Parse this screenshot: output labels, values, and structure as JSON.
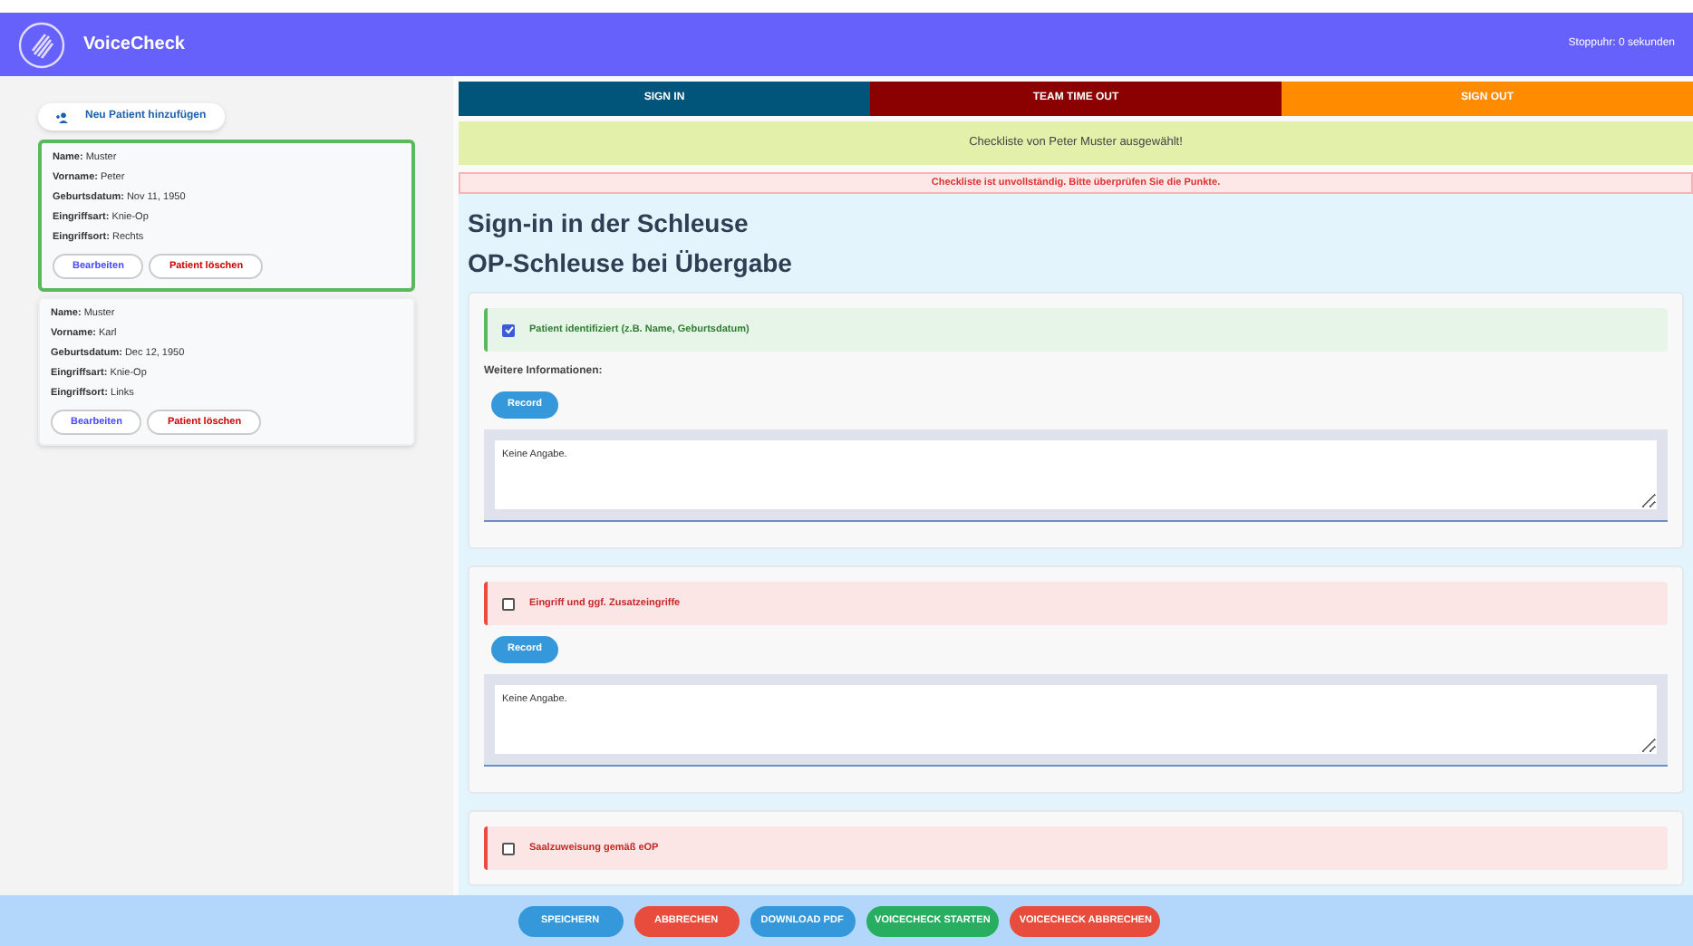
{
  "header": {
    "title": "VoiceCheck",
    "stopwatch": "Stoppuhr: 0 sekunden"
  },
  "sidebar": {
    "add_button": "Neu Patient hinzufügen",
    "patients": [
      {
        "selected": true,
        "fields": [
          {
            "label": "Name:",
            "value": "Muster"
          },
          {
            "label": "Vorname:",
            "value": "Peter"
          },
          {
            "label": "Geburtsdatum:",
            "value": "Nov 11, 1950"
          },
          {
            "label": "Eingriffsart:",
            "value": "Knie-Op"
          },
          {
            "label": "Eingriffsort:",
            "value": "Rechts"
          }
        ],
        "edit": "Bearbeiten",
        "delete": "Patient löschen"
      },
      {
        "selected": false,
        "fields": [
          {
            "label": "Name:",
            "value": "Muster"
          },
          {
            "label": "Vorname:",
            "value": "Karl"
          },
          {
            "label": "Geburtsdatum:",
            "value": "Dec 12, 1950"
          },
          {
            "label": "Eingriffsart:",
            "value": "Knie-Op"
          },
          {
            "label": "Eingriffsort:",
            "value": "Links"
          }
        ],
        "edit": "Bearbeiten",
        "delete": "Patient löschen"
      }
    ]
  },
  "tabs": [
    {
      "label": "SIGN IN",
      "color": "#01547a"
    },
    {
      "label": "TEAM TIME OUT",
      "color": "#8b0000"
    },
    {
      "label": "SIGN OUT",
      "color": "#ff8c00"
    }
  ],
  "notice": "Checkliste von Peter Muster ausgewählt!",
  "error": "Checkliste ist unvollständig. Bitte überprüfen Sie die Punkte.",
  "title": "Sign-in in der Schleuse",
  "subtitle": "OP-Schleuse bei Übergabe",
  "items": [
    {
      "label": "Patient identifiziert (z.B. Name, Geburtsdatum)",
      "checked": true,
      "details_label": "Weitere Informationen:",
      "record": "Record",
      "value": "Keine Angabe."
    },
    {
      "label": "Eingriff und ggf. Zusatzeingriffe",
      "checked": false,
      "record": "Record",
      "value": "Keine Angabe."
    },
    {
      "label": "Saalzuweisung gemäß eOP",
      "checked": false
    }
  ],
  "footer_buttons": [
    {
      "label": "SPEICHERN",
      "color": "#3498db"
    },
    {
      "label": "ABBRECHEN",
      "color": "#e74c3c"
    },
    {
      "label": "DOWNLOAD PDF",
      "color": "#3498db"
    },
    {
      "label": "VOICECHECK STARTEN",
      "color": "#27ae60"
    },
    {
      "label": "VOICECHECK ABBRECHEN",
      "color": "#e74c3c"
    }
  ]
}
